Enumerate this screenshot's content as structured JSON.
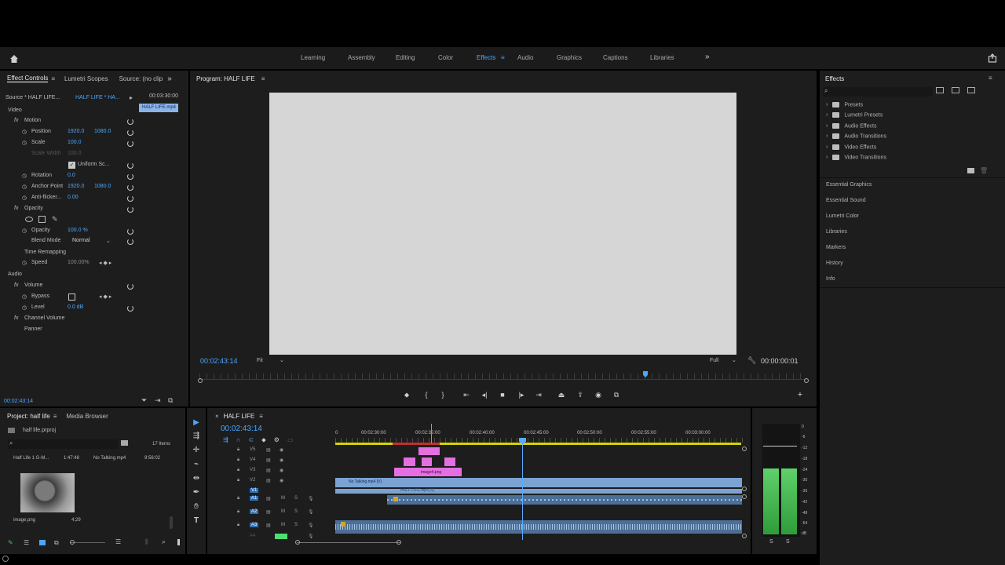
{
  "workspace": {
    "tabs": [
      "Learning",
      "Assembly",
      "Editing",
      "Color",
      "Effects",
      "Audio",
      "Graphics",
      "Captions",
      "Libraries"
    ],
    "active": "Effects",
    "more": "»"
  },
  "effect_controls": {
    "tabs": [
      "Effect Controls",
      "Lumetri Scopes",
      "Source: (no clip"
    ],
    "source_label": "Source * HALF LIFE...",
    "sequence_label": "HALF LIFE * HA...",
    "ruler_time": "00:03:30:00",
    "clip_label": "HALF LIFE.mp4",
    "section_video": "Video",
    "section_audio": "Audio",
    "rows": {
      "motion": "Motion",
      "position": "Position",
      "position_x": "1920.0",
      "position_y": "1080.0",
      "scale": "Scale",
      "scale_val": "100.0",
      "scale_width": "Scale Width",
      "scale_width_val": "100.0",
      "uniform": "Uniform Sc...",
      "rotation": "Rotation",
      "rotation_val": "0.0",
      "anchor": "Anchor Point",
      "anchor_x": "1920.0",
      "anchor_y": "1080.0",
      "antiflicker": "Anti-flicker...",
      "antiflicker_val": "0.00",
      "opacity_group": "Opacity",
      "opacity": "Opacity",
      "opacity_val": "100.0 %",
      "blend": "Blend Mode",
      "blend_val": "Normal",
      "time_remap": "Time Remapping",
      "speed": "Speed",
      "speed_val": "100.00%",
      "volume": "Volume",
      "bypass": "Bypass",
      "level": "Level",
      "level_val": "0.0 dB",
      "channel_volume": "Channel Volume",
      "panner": "Panner"
    },
    "timecode": "00:02:43:14"
  },
  "program": {
    "title": "Program: HALF LIFE",
    "timecode": "00:02:43:14",
    "fit": "Fit",
    "quality": "Full",
    "duration": "00:00:00:01"
  },
  "project": {
    "tabs": [
      "Project: half life",
      "Media Browser"
    ],
    "file": "half life.prproj",
    "items_count": "17 Items",
    "list": [
      {
        "name": "Half Life 1 G-M...",
        "dur": "1:47:48"
      },
      {
        "name": "No Talking.mp4",
        "dur": "9:56:02"
      }
    ],
    "thumb_name": "image.png",
    "thumb_dur": "4;29"
  },
  "timeline": {
    "tab": "HALF LIFE",
    "timecode": "00:02:43:14",
    "ruler": [
      "0",
      "00:02:30:00",
      "00:02:35:00",
      "00:02:40:00",
      "00:02:45:00",
      "00:02:50:00",
      "00:02:55:00",
      "00:03:00:00"
    ],
    "tracks": [
      "V5",
      "V4",
      "V3",
      "V2",
      "V1",
      "A1",
      "A2",
      "A3",
      "A4"
    ],
    "clip_image": "image4.png",
    "clip_no_talking": "No Talking.mp4 [V]",
    "clip_half_life": "HALF LIFE.mp4 [V]"
  },
  "meters": {
    "scale": [
      "0",
      "-6",
      "-12",
      "-18",
      "-24",
      "-30",
      "-36",
      "-42",
      "-48",
      "-54",
      "dB"
    ],
    "solo": [
      "S",
      "S"
    ]
  },
  "effects_panel": {
    "title": "Effects",
    "folders": [
      "Presets",
      "Lumetri Presets",
      "Audio Effects",
      "Audio Transitions",
      "Video Effects",
      "Video Transitions"
    ],
    "sections": [
      "Essential Graphics",
      "Essential Sound",
      "Lumetri Color",
      "Libraries",
      "Markers",
      "History",
      "Info"
    ]
  },
  "colors": {
    "accent": "#4aa7ff",
    "clip_pink": "#e36fe0",
    "clip_blue": "#7aa3d4",
    "audio_wave": "#5d84ad",
    "meter_green": "#4ac457",
    "timeline_bar": "#d4d400"
  }
}
